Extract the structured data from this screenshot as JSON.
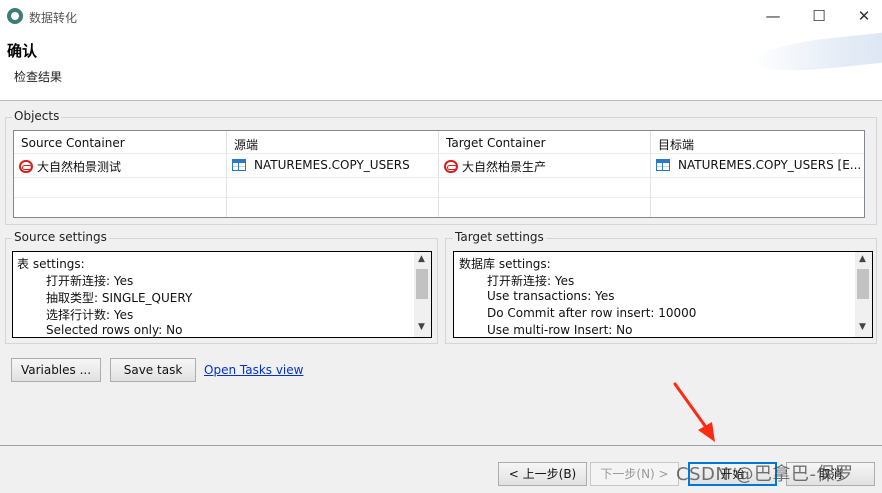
{
  "window": {
    "title": "数据转化",
    "minimize": "—",
    "maximize": "☐",
    "close": "✕"
  },
  "header": {
    "title": "确认",
    "subtitle": "检查结果"
  },
  "objects": {
    "group_label": "Objects",
    "columns": [
      "Source Container",
      "源端",
      "Target Container",
      "目标端"
    ],
    "row": {
      "source_container": "大自然柏景测试",
      "source": "NATUREMES.COPY_USERS",
      "target_container": "大自然柏景生产",
      "target": "NATUREMES.COPY_USERS [E..."
    }
  },
  "source_settings": {
    "group_label": "Source settings",
    "lines": [
      "表 settings:",
      "打开新连接: Yes",
      "抽取类型: SINGLE_QUERY",
      "选择行计数: Yes",
      "Selected rows only: No"
    ]
  },
  "target_settings": {
    "group_label": "Target settings",
    "lines": [
      "数据库 settings:",
      "打开新连接: Yes",
      "Use transactions: Yes",
      "Do Commit after row insert: 10000",
      "Use multi-row Insert: No"
    ]
  },
  "actions": {
    "variables": "Variables ...",
    "save_task": "Save task",
    "open_tasks_view": "Open Tasks view"
  },
  "footer": {
    "back": "< 上一步(B)",
    "next": "下一步(N) >",
    "finish": "开始",
    "cancel": "取消"
  },
  "watermark": "CSDN @巴拿巴-保罗",
  "colors": {
    "accent": "#0078d7",
    "link": "#0033cc",
    "arrow": "#ff2a12"
  }
}
